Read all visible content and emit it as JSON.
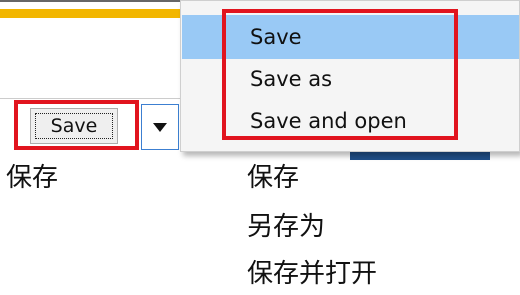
{
  "split_button": {
    "save_label": "Save"
  },
  "dropdown_menu": {
    "items": [
      {
        "label": "Save",
        "selected": true
      },
      {
        "label": "Save as",
        "selected": false
      },
      {
        "label": "Save and open",
        "selected": false
      }
    ]
  },
  "captions": {
    "left": "保存",
    "right": [
      "保存",
      "另存为",
      "保存并打开"
    ]
  },
  "colors": {
    "highlight_border": "#e1141e",
    "menu_selected": "#99c9f5",
    "accent_stripe": "#f2b600",
    "blue_strip": "#1f4f88"
  },
  "icons": {
    "dropdown_arrow": "caret-down-icon"
  }
}
